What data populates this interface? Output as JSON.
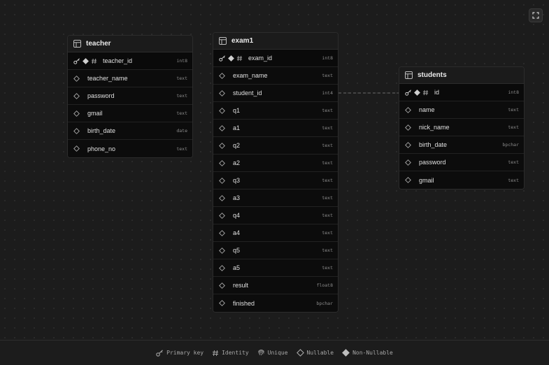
{
  "toolbar": {
    "fullscreen_icon": "expand-icon"
  },
  "tables": {
    "teacher": {
      "name": "teacher",
      "columns": [
        {
          "name": "teacher_id",
          "type": "int8",
          "primary_key": true,
          "identity": true,
          "nullable": false
        },
        {
          "name": "teacher_name",
          "type": "text",
          "nullable": true
        },
        {
          "name": "password",
          "type": "text",
          "nullable": true
        },
        {
          "name": "gmail",
          "type": "text",
          "nullable": true
        },
        {
          "name": "birth_date",
          "type": "date",
          "nullable": true
        },
        {
          "name": "phone_no",
          "type": "text",
          "nullable": true
        }
      ]
    },
    "exam1": {
      "name": "exam1",
      "columns": [
        {
          "name": "exam_id",
          "type": "int8",
          "primary_key": true,
          "identity": true,
          "nullable": false
        },
        {
          "name": "exam_name",
          "type": "text",
          "nullable": true
        },
        {
          "name": "student_id",
          "type": "int4",
          "nullable": true
        },
        {
          "name": "q1",
          "type": "text",
          "nullable": true
        },
        {
          "name": "a1",
          "type": "text",
          "nullable": true
        },
        {
          "name": "q2",
          "type": "text",
          "nullable": true
        },
        {
          "name": "a2",
          "type": "text",
          "nullable": true
        },
        {
          "name": "q3",
          "type": "text",
          "nullable": true
        },
        {
          "name": "a3",
          "type": "text",
          "nullable": true
        },
        {
          "name": "q4",
          "type": "text",
          "nullable": true
        },
        {
          "name": "a4",
          "type": "text",
          "nullable": true
        },
        {
          "name": "q5",
          "type": "text",
          "nullable": true
        },
        {
          "name": "a5",
          "type": "text",
          "nullable": true
        },
        {
          "name": "result",
          "type": "float8",
          "nullable": true
        },
        {
          "name": "finished",
          "type": "bpchar",
          "nullable": true
        }
      ]
    },
    "students": {
      "name": "students",
      "columns": [
        {
          "name": "id",
          "type": "int8",
          "primary_key": true,
          "identity": true,
          "nullable": false
        },
        {
          "name": "name",
          "type": "text",
          "nullable": true
        },
        {
          "name": "nick_name",
          "type": "text",
          "nullable": true
        },
        {
          "name": "birth_date",
          "type": "bpchar",
          "nullable": true
        },
        {
          "name": "password",
          "type": "text",
          "nullable": true
        },
        {
          "name": "gmail",
          "type": "text",
          "nullable": true
        }
      ]
    }
  },
  "relation": {
    "from": "exam1.student_id",
    "to": "students.id",
    "style": "dashed"
  },
  "legend": {
    "primary_key": "Primary key",
    "identity": "Identity",
    "unique": "Unique",
    "nullable": "Nullable",
    "non_nullable": "Non-Nullable"
  },
  "colors": {
    "background": "#1c1c1c",
    "card": "#111111",
    "text": "#e0e0e0",
    "muted": "#8d8d8d",
    "relation_line": "#6b6b6b"
  }
}
